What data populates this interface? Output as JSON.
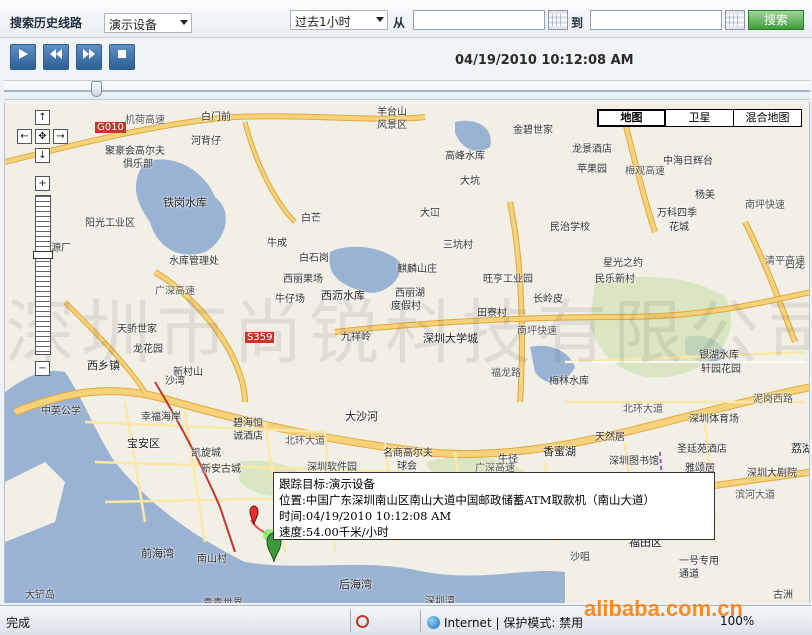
{
  "toolbar": {
    "history_label": "搜索历史线路",
    "device_select": "演示设备",
    "period_select": "过去1小时",
    "from_label": "从",
    "from_value": "",
    "to_label": "到",
    "to_value": "",
    "search_label": "搜索"
  },
  "playback": {
    "buttons": [
      "play",
      "rewind",
      "fast-forward",
      "stop"
    ],
    "timestamp": "04/19/2010 10:12:08 AM",
    "progress_fraction": 0.11
  },
  "map": {
    "types": [
      "地图",
      "卫星",
      "混合地图"
    ],
    "active_type": "地图",
    "watermark": "深圳市尚锐科技有限公司",
    "labels": [
      {
        "text": "机荷高速"
      },
      {
        "text": "白门前"
      },
      {
        "text": "羊台山"
      },
      {
        "text": "风景区"
      },
      {
        "text": "聚豪会高尔夫"
      },
      {
        "text": "俱乐部"
      },
      {
        "text": "河背仔"
      },
      {
        "text": "金碧世家"
      },
      {
        "text": "龙景酒店"
      },
      {
        "text": "中海日辉台"
      },
      {
        "text": "高峰水库"
      },
      {
        "text": "苹果园"
      },
      {
        "text": "杨美"
      },
      {
        "text": "铁岗水库"
      },
      {
        "text": "大坑"
      },
      {
        "text": "民治学校"
      },
      {
        "text": "大冚"
      },
      {
        "text": "万科四季"
      },
      {
        "text": "花城"
      },
      {
        "text": "南坪快速"
      },
      {
        "text": "阳光工业区"
      },
      {
        "text": "白芒"
      },
      {
        "text": "牛成"
      },
      {
        "text": "白石岗"
      },
      {
        "text": "三坑村"
      },
      {
        "text": "源厂"
      },
      {
        "text": "水库管理处"
      },
      {
        "text": "麒麟山庄"
      },
      {
        "text": "旺亨工业园"
      },
      {
        "text": "星光之约"
      },
      {
        "text": "民乐新村"
      },
      {
        "text": "石龙"
      },
      {
        "text": "西丽果场"
      },
      {
        "text": "西沥水库"
      },
      {
        "text": "西丽湖"
      },
      {
        "text": "度假村"
      },
      {
        "text": "长岭皮"
      },
      {
        "text": "牛仔场"
      },
      {
        "text": "田寮村"
      },
      {
        "text": "天骄世家"
      },
      {
        "text": "龙花园"
      },
      {
        "text": "九祥岭"
      },
      {
        "text": "深圳大学城"
      },
      {
        "text": "南坪快速"
      },
      {
        "text": "西乡镇"
      },
      {
        "text": "新村山"
      },
      {
        "text": "福龙路"
      },
      {
        "text": "梅林水库"
      },
      {
        "text": "银湖水库"
      },
      {
        "text": "轩园花园"
      },
      {
        "text": "中英公学"
      },
      {
        "text": "幸福海岸"
      },
      {
        "text": "大沙河"
      },
      {
        "text": "北环大道"
      },
      {
        "text": "泥岗西路"
      },
      {
        "text": "宝安区"
      },
      {
        "text": "碧海恒"
      },
      {
        "text": "诚酒店"
      },
      {
        "text": "北环大道"
      },
      {
        "text": "香蜜湖"
      },
      {
        "text": "深圳体育场"
      },
      {
        "text": "凯旋城"
      },
      {
        "text": "名商高尔夫"
      },
      {
        "text": "球会"
      },
      {
        "text": "天然居"
      },
      {
        "text": "圣廷苑酒店"
      },
      {
        "text": "荔湖"
      },
      {
        "text": "新安古城"
      },
      {
        "text": "深圳软件园"
      },
      {
        "text": "牛径"
      },
      {
        "text": "深圳图书馆"
      },
      {
        "text": "雅颂居"
      },
      {
        "text": "深圳大剧院"
      },
      {
        "text": "前海湾"
      },
      {
        "text": "南山村"
      },
      {
        "text": "后海湾"
      },
      {
        "text": "沙咀"
      },
      {
        "text": "福田区"
      },
      {
        "text": "一号专用"
      },
      {
        "text": "通道"
      },
      {
        "text": "大铲岛"
      },
      {
        "text": "青青世界"
      },
      {
        "text": "古洲"
      },
      {
        "text": "深圳湾"
      },
      {
        "text": "广深高速"
      },
      {
        "text": "梅观高速"
      },
      {
        "text": "清平高速"
      },
      {
        "text": "滨河大道"
      },
      {
        "text": "广深高速"
      },
      {
        "text": "沙湾"
      },
      {
        "text": "G010"
      },
      {
        "text": "S359"
      }
    ]
  },
  "info": {
    "target": "跟踪目标:演示设备",
    "location": "位置:中国广东深圳南山区南山大道中国邮政储蓄ATM取款机（南山大道）",
    "time": "时间:04/19/2010 10:12:08 AM",
    "speed": "速度:54.00千米/小时"
  },
  "status": {
    "text": "完成",
    "zone": "Internet | 保护模式: 禁用",
    "zoom": "100%",
    "watermark": "alibaba.com.cn"
  },
  "colors": {
    "accent": "#2d5f98",
    "search_green": "#3f9b3a",
    "highway": "#f3c96a",
    "water": "#9bb3d3"
  }
}
